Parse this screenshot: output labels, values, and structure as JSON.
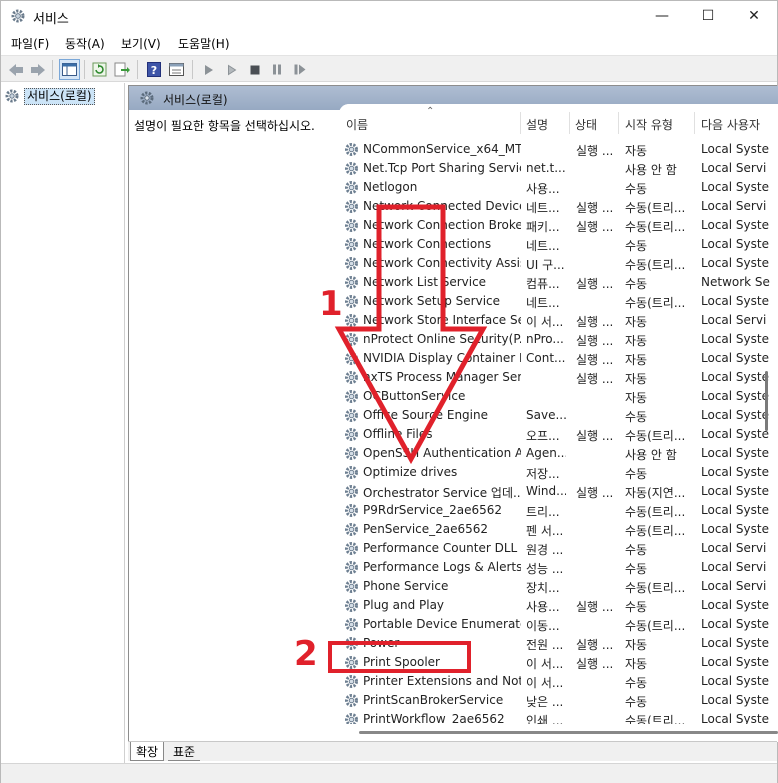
{
  "window": {
    "title": "서비스"
  },
  "menu": [
    "파일(F)",
    "동작(A)",
    "보기(V)",
    "도움말(H)"
  ],
  "tree": {
    "root": "서비스(로컬)"
  },
  "panel": {
    "header": "서비스(로컬)",
    "description": "설명이 필요한 항목을 선택하십시오."
  },
  "columns": [
    "이름",
    "설명",
    "상태",
    "시작 유형",
    "다음 사용자"
  ],
  "services": [
    {
      "name": "NCommonService_x64_MT",
      "desc": "",
      "status": "실행 ...",
      "type": "자동",
      "logon": "Local Syste"
    },
    {
      "name": "Net.Tcp Port Sharing Service",
      "desc": "net.t...",
      "status": "",
      "type": "사용 안 함",
      "logon": "Local Servi"
    },
    {
      "name": "Netlogon",
      "desc": "사용...",
      "status": "",
      "type": "수동",
      "logon": "Local Syste"
    },
    {
      "name": "Network Connected Device...",
      "desc": "네트...",
      "status": "실행 ...",
      "type": "수동(트리...",
      "logon": "Local Servi"
    },
    {
      "name": "Network Connection Broker",
      "desc": "패키...",
      "status": "실행 ...",
      "type": "수동(트리...",
      "logon": "Local Syste"
    },
    {
      "name": "Network Connections",
      "desc": "네트...",
      "status": "",
      "type": "수동",
      "logon": "Local Syste"
    },
    {
      "name": "Network Connectivity Assis...",
      "desc": "UI 구...",
      "status": "",
      "type": "수동(트리...",
      "logon": "Local Syste"
    },
    {
      "name": "Network List Service",
      "desc": "컴퓨...",
      "status": "실행 ...",
      "type": "수동",
      "logon": "Network Se"
    },
    {
      "name": "Network Setup Service",
      "desc": "네트...",
      "status": "",
      "type": "수동(트리...",
      "logon": "Local Syste"
    },
    {
      "name": "Network Store Interface Se...",
      "desc": "이 서...",
      "status": "실행 ...",
      "type": "자동",
      "logon": "Local Servi"
    },
    {
      "name": "nProtect Online Security(P...",
      "desc": "nPro...",
      "status": "실행 ...",
      "type": "자동",
      "logon": "Local Syste"
    },
    {
      "name": "NVIDIA Display Container LS",
      "desc": "Cont...",
      "status": "실행 ...",
      "type": "자동",
      "logon": "Local Syste"
    },
    {
      "name": "nxTS Process Manager Ser...",
      "desc": "",
      "status": "실행 ...",
      "type": "자동",
      "logon": "Local Syste"
    },
    {
      "name": "OCButtonService",
      "desc": "",
      "status": "",
      "type": "자동",
      "logon": "Local Syste"
    },
    {
      "name": "Office  Source Engine",
      "desc": "Save...",
      "status": "",
      "type": "수동",
      "logon": "Local Syste"
    },
    {
      "name": "Offline Files",
      "desc": "오프...",
      "status": "실행 ...",
      "type": "수동(트리...",
      "logon": "Local Syste"
    },
    {
      "name": "OpenSSH Authentication A...",
      "desc": "Agen...",
      "status": "",
      "type": "사용 안 함",
      "logon": "Local Syste"
    },
    {
      "name": "Optimize drives",
      "desc": "저장...",
      "status": "",
      "type": "수동",
      "logon": "Local Syste"
    },
    {
      "name": "Orchestrator Service 업데...",
      "desc": "Wind...",
      "status": "실행 ...",
      "type": "자동(지연...",
      "logon": "Local Syste"
    },
    {
      "name": "P9RdrService_2ae6562",
      "desc": "트리...",
      "status": "",
      "type": "수동(트리...",
      "logon": "Local Syste"
    },
    {
      "name": "PenService_2ae6562",
      "desc": "펜 서...",
      "status": "",
      "type": "수동(트리...",
      "logon": "Local Syste"
    },
    {
      "name": "Performance Counter DLL ...",
      "desc": "원경 ...",
      "status": "",
      "type": "수동",
      "logon": "Local Servi"
    },
    {
      "name": "Performance Logs & Alerts",
      "desc": "성능 ...",
      "status": "",
      "type": "수동",
      "logon": "Local Servi"
    },
    {
      "name": "Phone Service",
      "desc": "장치...",
      "status": "",
      "type": "수동(트리...",
      "logon": "Local Servi"
    },
    {
      "name": "Plug and Play",
      "desc": "사용...",
      "status": "실행 ...",
      "type": "수동",
      "logon": "Local Syste"
    },
    {
      "name": "Portable Device Enumerato...",
      "desc": "이동...",
      "status": "",
      "type": "수동(트리...",
      "logon": "Local Syste"
    },
    {
      "name": "Power",
      "desc": "전원 ...",
      "status": "실행 ...",
      "type": "자동",
      "logon": "Local Syste"
    },
    {
      "name": "Print Spooler",
      "desc": "이 서...",
      "status": "실행 ...",
      "type": "자동",
      "logon": "Local Syste"
    },
    {
      "name": "Printer Extensions and Noti...",
      "desc": "이 서...",
      "status": "",
      "type": "수동",
      "logon": "Local Syste"
    },
    {
      "name": "PrintScanBrokerService",
      "desc": "낮은 ...",
      "status": "",
      "type": "수동",
      "logon": "Local Syste"
    },
    {
      "name": "PrintWorkflow_2ae6562",
      "desc": "인쇄 ...",
      "status": "",
      "type": "수동(트리...",
      "logon": "Local Syste"
    }
  ],
  "tabs": [
    "확장",
    "표준"
  ],
  "annotations": {
    "step1": "1",
    "step2": "2",
    "color": "#e0212b"
  }
}
